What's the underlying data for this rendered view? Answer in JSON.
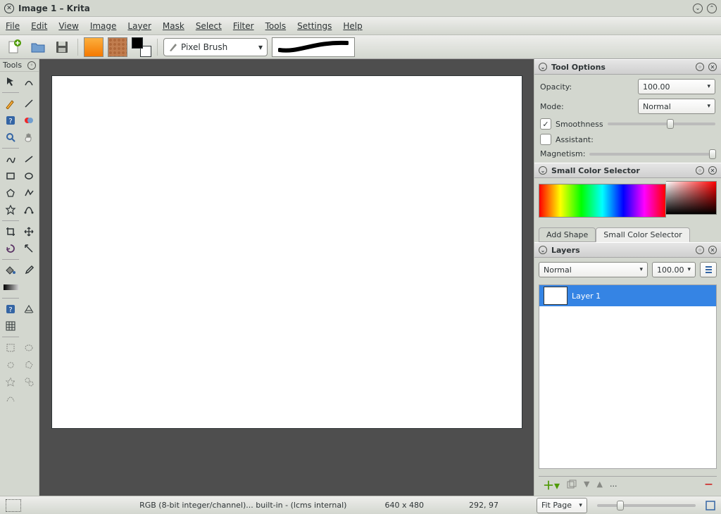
{
  "window": {
    "title": "Image 1 – Krita"
  },
  "menu": [
    "File",
    "Edit",
    "View",
    "Image",
    "Layer",
    "Mask",
    "Select",
    "Filter",
    "Tools",
    "Settings",
    "Help"
  ],
  "brush_selector": "Pixel Brush",
  "toolbox": {
    "title": "Tools"
  },
  "tool_options": {
    "title": "Tool Options",
    "opacity_label": "Opacity:",
    "opacity_value": "100.00",
    "mode_label": "Mode:",
    "mode_value": "Normal",
    "smoothness_label": "Smoothness",
    "assistant_label": "Assistant:",
    "magnetism_label": "Magnetism:"
  },
  "color_selector": {
    "title": "Small Color Selector"
  },
  "tabs": {
    "add_shape": "Add Shape",
    "color": "Small Color Selector"
  },
  "layers": {
    "title": "Layers",
    "mode": "Normal",
    "opacity": "100.00",
    "layer1": "Layer 1",
    "more": "..."
  },
  "status": {
    "color_info": "RGB (8-bit integer/channel)... built-in - (lcms internal)",
    "dims": "640 x 480",
    "cursor": "292, 97",
    "zoom": "Fit Page"
  }
}
